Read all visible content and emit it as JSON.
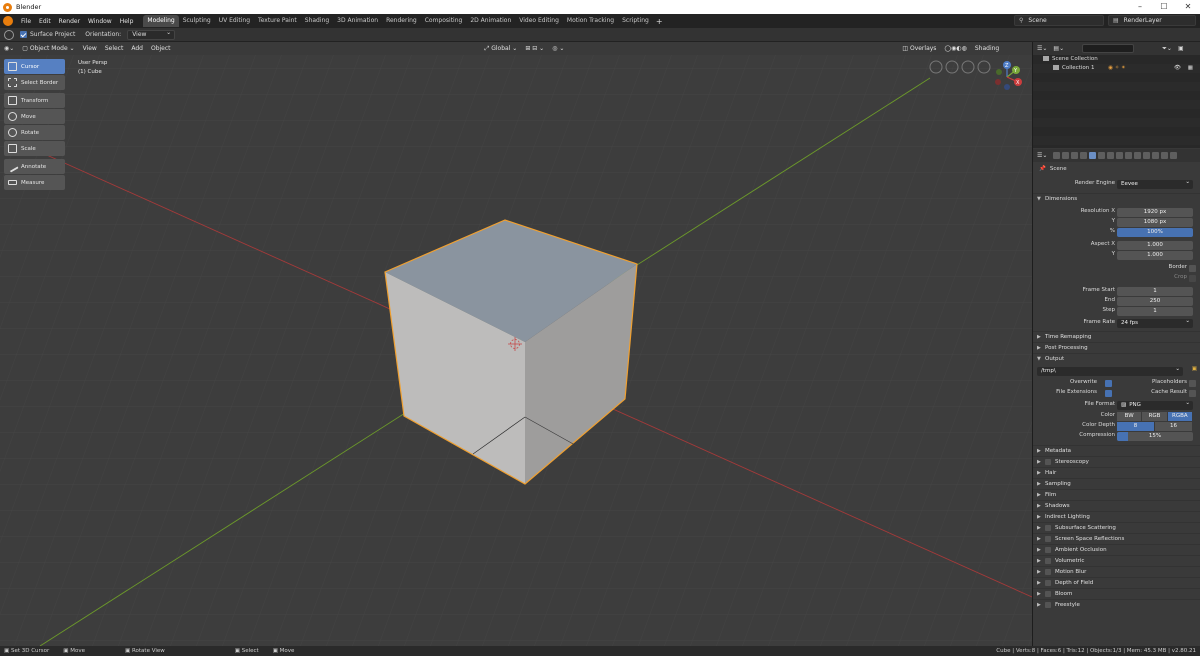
{
  "window": {
    "title": "Blender"
  },
  "menubar": {
    "menus": [
      "File",
      "Edit",
      "Render",
      "Window",
      "Help"
    ],
    "workspaces": [
      "Modeling",
      "Sculpting",
      "UV Editing",
      "Texture Paint",
      "Shading",
      "3D Animation",
      "Rendering",
      "Compositing",
      "2D Animation",
      "Video Editing",
      "Motion Tracking",
      "Scripting"
    ],
    "add_tab": "+",
    "scene": "Scene",
    "view_layer": "RenderLayer"
  },
  "tool_header": {
    "surface_project": "Surface Project",
    "orientation_label": "Orientation:",
    "orientation_value": "View"
  },
  "viewport_header": {
    "mode": "Object Mode",
    "menus": [
      "View",
      "Select",
      "Add",
      "Object"
    ],
    "transform_orientation": "Global",
    "overlays": "Overlays",
    "shading": "Shading"
  },
  "toolbar": {
    "tools": [
      "Cursor",
      "Select Border",
      "Transform",
      "Move",
      "Rotate",
      "Scale",
      "Annotate",
      "Measure"
    ],
    "active": "Cursor"
  },
  "viewport_info": {
    "view": "User Persp",
    "object": "(1) Cube"
  },
  "gizmo": {
    "z": "Z",
    "y": "Y",
    "x": "X"
  },
  "outliner": {
    "scene_collection": "Scene Collection",
    "collection": "Collection 1"
  },
  "properties": {
    "context": "Scene",
    "render_engine_label": "Render Engine",
    "render_engine": "Eevee",
    "dimensions": {
      "title": "Dimensions",
      "resolution_x_label": "Resolution X",
      "resolution_x": "1920 px",
      "y_label": "Y",
      "resolution_y": "1080 px",
      "pct_label": "%",
      "resolution_pct": "100%",
      "aspect_x_label": "Aspect X",
      "aspect_x": "1.000",
      "aspect_y_label": "Y",
      "aspect_y": "1.000",
      "border_label": "Border",
      "crop_label": "Crop",
      "frame_start_label": "Frame Start",
      "frame_start": "1",
      "end_label": "End",
      "frame_end": "250",
      "step_label": "Step",
      "frame_step": "1",
      "frame_rate_label": "Frame Rate",
      "frame_rate": "24 fps"
    },
    "time_remapping": "Time Remapping",
    "post_processing": "Post Processing",
    "output": {
      "title": "Output",
      "path": "/tmp\\",
      "overwrite_label": "Overwrite",
      "placeholders_label": "Placeholders",
      "file_extensions_label": "File Extensions",
      "cache_result_label": "Cache Result",
      "file_format_label": "File Format",
      "file_format": "PNG",
      "color_label": "Color",
      "color_options": [
        "BW",
        "RGB",
        "RGBA"
      ],
      "color_selected": "RGBA",
      "color_depth_label": "Color Depth",
      "color_depth_options": [
        "8",
        "16"
      ],
      "color_depth_selected": "8",
      "compression_label": "Compression",
      "compression": "15%",
      "compression_fraction": 0.15
    },
    "sections": [
      {
        "label": "Metadata",
        "checkbox": false
      },
      {
        "label": "Stereoscopy",
        "checkbox": true
      },
      {
        "label": "Hair",
        "checkbox": false
      },
      {
        "label": "Sampling",
        "checkbox": false
      },
      {
        "label": "Film",
        "checkbox": false
      },
      {
        "label": "Shadows",
        "checkbox": false
      },
      {
        "label": "Indirect Lighting",
        "checkbox": false
      },
      {
        "label": "Subsurface Scattering",
        "checkbox": true
      },
      {
        "label": "Screen Space Reflections",
        "checkbox": true
      },
      {
        "label": "Ambient Occlusion",
        "checkbox": true
      },
      {
        "label": "Volumetric",
        "checkbox": true
      },
      {
        "label": "Motion Blur",
        "checkbox": true
      },
      {
        "label": "Depth of Field",
        "checkbox": true
      },
      {
        "label": "Bloom",
        "checkbox": true
      },
      {
        "label": "Freestyle",
        "checkbox": true
      }
    ]
  },
  "statusbar": {
    "left": [
      "Set 3D Cursor",
      "Move",
      "Rotate View",
      "Select",
      "Move"
    ],
    "stats": "Cube | Verts:8 | Faces:6 | Tris:12 | Objects:1/3 | Mem: 45.3 MB | v2.80.21"
  },
  "colors": {
    "accent": "#4772b3",
    "selection_outline": "#f0a030",
    "x_axis": "#a33a3a",
    "y_axis": "#6c9a2a"
  }
}
